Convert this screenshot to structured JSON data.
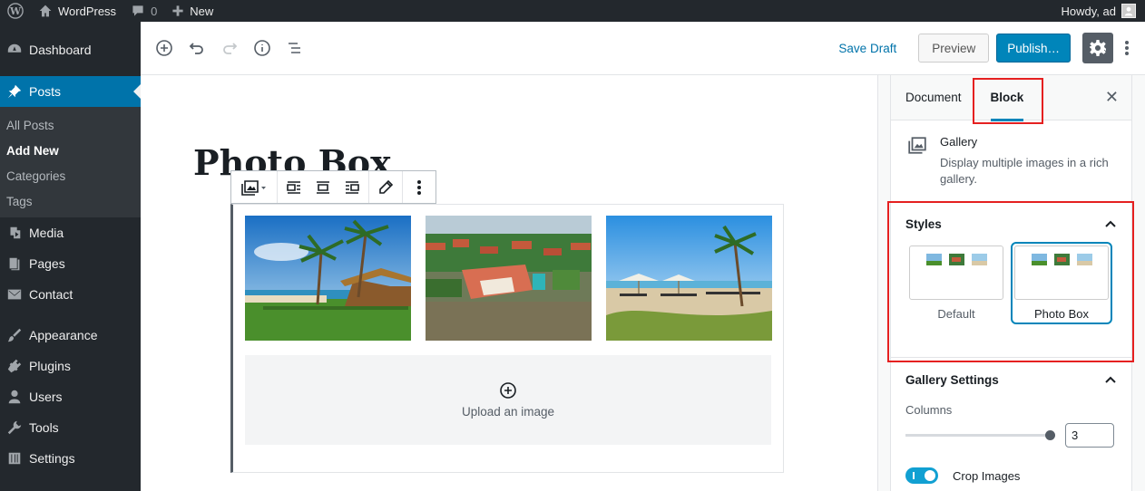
{
  "adminbar": {
    "site_name": "WordPress",
    "comments_count": "0",
    "new_label": "New",
    "howdy": "Howdy, ad"
  },
  "menu": {
    "items": [
      {
        "label": "Dashboard",
        "icon": "dashboard-icon"
      },
      {
        "label": "Posts",
        "icon": "pushpin-icon"
      },
      {
        "label": "Media",
        "icon": "media-icon"
      },
      {
        "label": "Pages",
        "icon": "pages-icon"
      },
      {
        "label": "Contact",
        "icon": "envelope-icon"
      },
      {
        "label": "Appearance",
        "icon": "paintbrush-icon"
      },
      {
        "label": "Plugins",
        "icon": "plug-icon"
      },
      {
        "label": "Users",
        "icon": "user-icon"
      },
      {
        "label": "Tools",
        "icon": "wrench-icon"
      },
      {
        "label": "Settings",
        "icon": "sliders-icon"
      }
    ],
    "submenu": [
      "All Posts",
      "Add New",
      "Categories",
      "Tags"
    ]
  },
  "header": {
    "save_draft": "Save Draft",
    "preview": "Preview",
    "publish": "Publish…"
  },
  "post": {
    "title": "Photo Box",
    "upload_label": "Upload an image"
  },
  "sidebar": {
    "tab_document": "Document",
    "tab_block": "Block",
    "close": "✕",
    "block_title": "Gallery",
    "block_desc": "Display multiple images in a rich gallery.",
    "styles_title": "Styles",
    "style_default": "Default",
    "style_photobox": "Photo Box",
    "gallery_settings_title": "Gallery Settings",
    "columns_label": "Columns",
    "columns_value": "3",
    "crop_label": "Crop Images"
  },
  "colors": {
    "admin_dark": "#23282d",
    "accent": "#0085ba",
    "highlight": "#e52020"
  }
}
